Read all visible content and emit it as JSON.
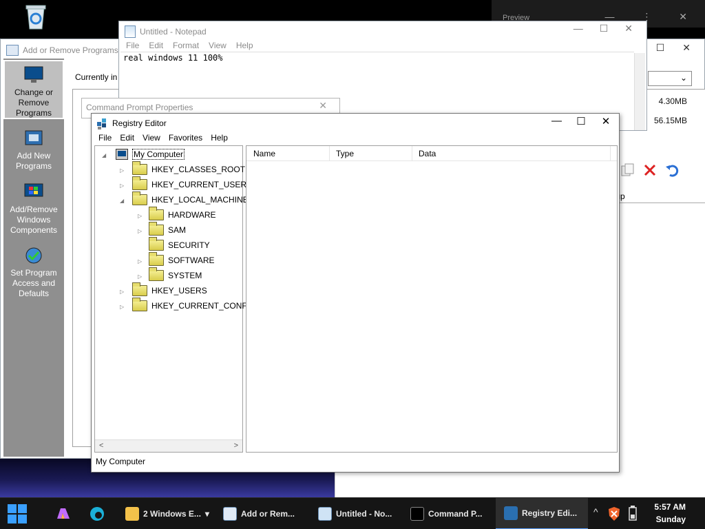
{
  "desktop": {
    "recycle_bin_icon": "recycle-bin-icon"
  },
  "bg_window": {
    "title": "Preview",
    "controls": [
      "—",
      "⋮⋮",
      "✕"
    ]
  },
  "arp": {
    "title": "Add or Remove Programs",
    "currently_label": "Currently in",
    "sidebar": [
      {
        "label": "Change or Remove Programs",
        "icon": "monitor-icon"
      },
      {
        "label": "Add New Programs",
        "icon": "add-programs-icon"
      },
      {
        "label": "Add/Remove Windows Components",
        "icon": "windows-components-icon"
      },
      {
        "label": "Set Program Access and Defaults",
        "icon": "program-defaults-icon"
      }
    ],
    "sizes": [
      "4.30MB",
      "56.15MB"
    ],
    "dropdown_arrow": "⌄"
  },
  "tool_window": {
    "startup_label": "rtup"
  },
  "notepad": {
    "title": "Untitled - Notepad",
    "menu": [
      "File",
      "Edit",
      "Format",
      "View",
      "Help"
    ],
    "content": "real windows 11 100%"
  },
  "cmdprops": {
    "title": "Command Prompt Properties"
  },
  "regedit": {
    "title": "Registry Editor",
    "menu": [
      "File",
      "Edit",
      "View",
      "Favorites",
      "Help"
    ],
    "tree": {
      "root": "My Computer",
      "hives": [
        "HKEY_CLASSES_ROOT",
        "HKEY_CURRENT_USER",
        "HKEY_LOCAL_MACHINE"
      ],
      "hklm_children": [
        "HARDWARE",
        "SAM",
        "SECURITY",
        "SOFTWARE",
        "SYSTEM"
      ],
      "hives_after": [
        "HKEY_USERS",
        "HKEY_CURRENT_CONFIG"
      ]
    },
    "columns": [
      "Name",
      "Type",
      "Data"
    ],
    "status": "My Computer"
  },
  "taskbar": {
    "items": [
      {
        "label": "2 Windows E...",
        "icon": "folder-icon"
      },
      {
        "label": "Add or Rem...",
        "icon": "add-remove-programs-icon"
      },
      {
        "label": "Untitled - No...",
        "icon": "notepad-icon"
      },
      {
        "label": "Command P...",
        "icon": "command-prompt-icon"
      },
      {
        "label": "Registry Edi...",
        "icon": "registry-editor-icon"
      }
    ],
    "time": "5:57 AM",
    "day": "Sunday"
  }
}
